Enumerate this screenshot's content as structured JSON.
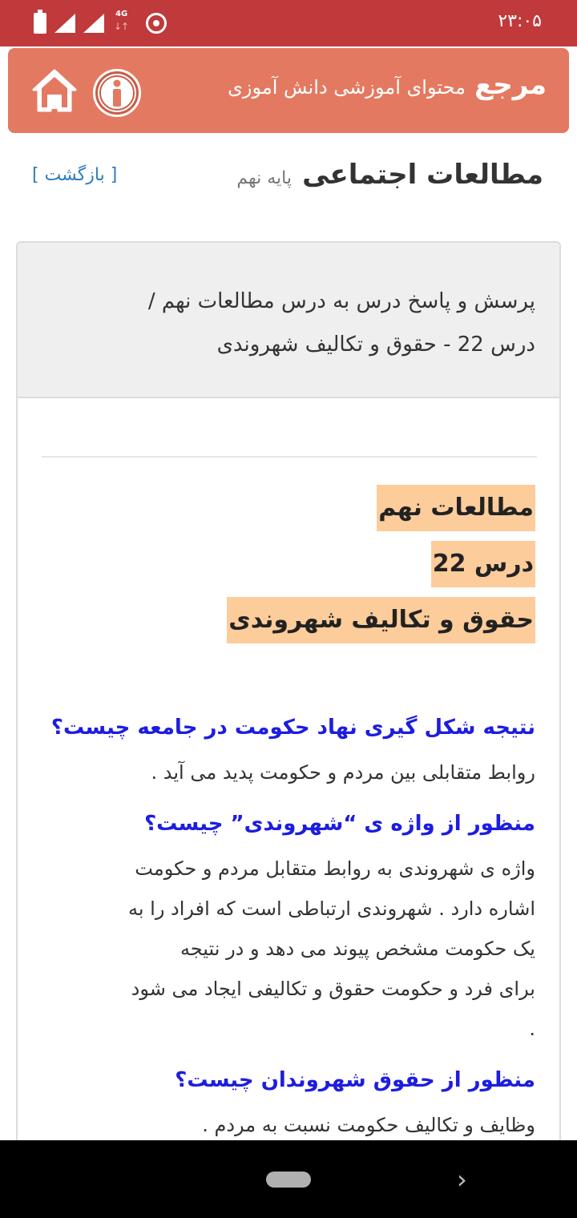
{
  "status_bar": {
    "time": "۲۳:۰۵",
    "network_label": "4G",
    "icons": [
      "battery-icon",
      "signal-icon",
      "signal-icon",
      "network-4g-icon",
      "hotspot-icon"
    ]
  },
  "header": {
    "title": "مرجع",
    "subtitle": "محتوای آموزشی دانش آموزی",
    "info_icon": "info-icon",
    "home_icon": "home-icon",
    "colors": {
      "background": "#e47961",
      "status_bar": "#c0393b"
    }
  },
  "page": {
    "title": "مطالعات اجتماعی",
    "grade": "پایه نهم",
    "back_label": "[ بازگشت ]"
  },
  "card": {
    "heading_line1": "پرسش و پاسخ درس به درس مطالعات نهم /",
    "heading_line2": "درس 22 - حقوق و تکالیف شهروندی",
    "highlights": [
      "مطالعات نهم",
      "درس 22",
      "حقوق و تکالیف شهروندی"
    ],
    "qa": [
      {
        "question": "نتیجه شکل گیری نهاد حکومت در جامعه چیست؟",
        "answer_lines": [
          "روابط متقابلی بین مردم و حکومت پدید می آید ."
        ]
      },
      {
        "question": "منظور از واژه ی “شهروندی” چیست؟",
        "answer_lines": [
          "واژه ی شهروندی به روابط متقابل مردم و حکومت",
          "اشاره دارد . شهروندی ارتباطی است که افراد را به",
          "یک حکومت مشخص پیوند می دهد و در نتیجه",
          "برای فرد و حکومت حقوق و تکالیفی ایجاد می شود",
          "."
        ]
      },
      {
        "question": "منظور از حقوق شهروندان چیست؟",
        "answer_lines": [
          "وظایف و تکالیف حکومت نسبت به مردم ."
        ]
      }
    ]
  },
  "nav_bar": {
    "icons": [
      "home-pill-icon",
      "chevron-right-icon"
    ]
  }
}
